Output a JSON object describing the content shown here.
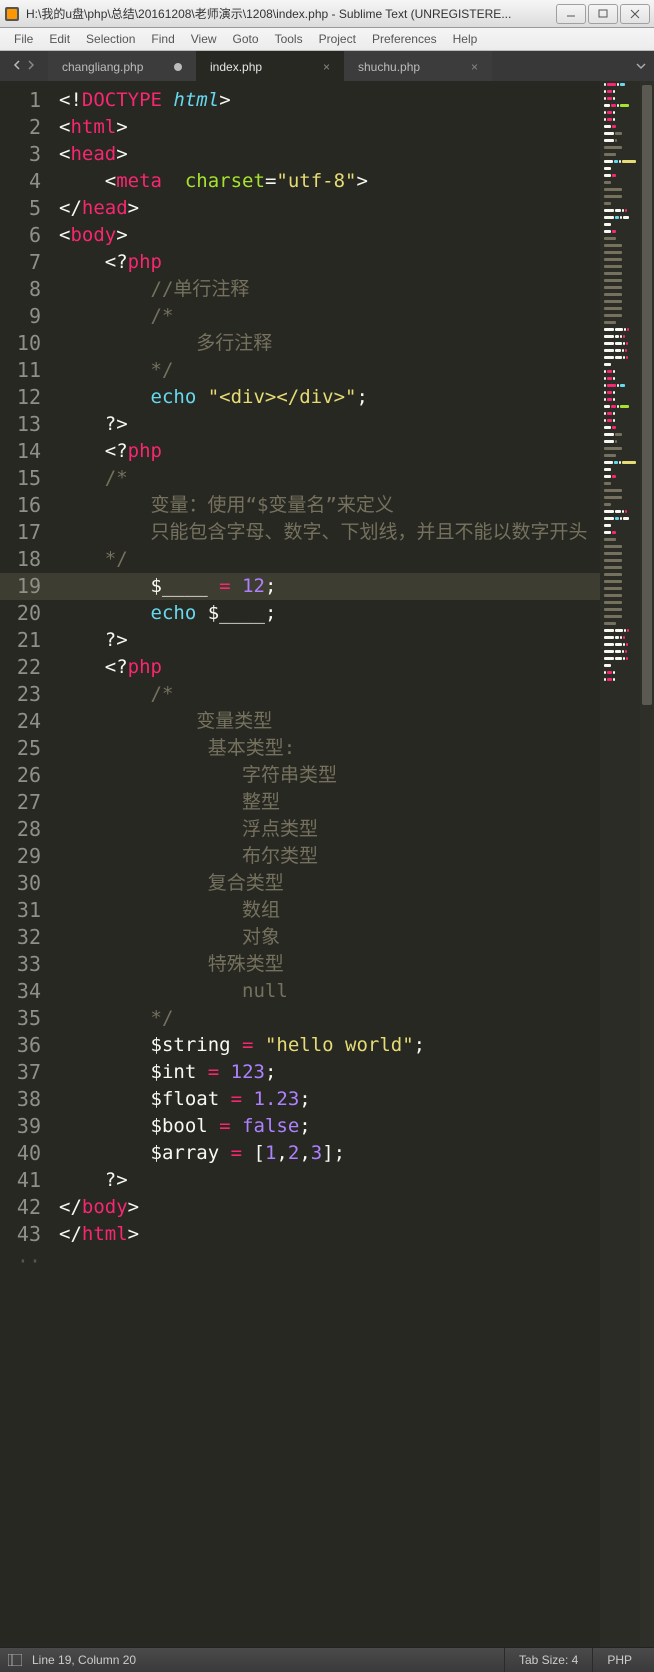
{
  "titlebar": {
    "title": "H:\\我的u盘\\php\\总结\\20161208\\老师演示\\1208\\index.php - Sublime Text (UNREGISTERE..."
  },
  "menu": {
    "items": [
      "File",
      "Edit",
      "Selection",
      "Find",
      "View",
      "Goto",
      "Tools",
      "Project",
      "Preferences",
      "Help"
    ]
  },
  "tabs": {
    "items": [
      {
        "label": "changliang.php",
        "active": false,
        "dirty": true,
        "closeable": false
      },
      {
        "label": "index.php",
        "active": true,
        "dirty": false,
        "closeable": true
      },
      {
        "label": "shuchu.php",
        "active": false,
        "dirty": false,
        "closeable": true
      }
    ]
  },
  "editor": {
    "active_line": 19,
    "lines": [
      {
        "n": 1,
        "segs": [
          [
            "<!",
            "p-white"
          ],
          [
            "DOCTYPE",
            "p-red"
          ],
          [
            " ",
            "p-white"
          ],
          [
            "html",
            "p-blue"
          ],
          [
            ">",
            "p-white"
          ]
        ]
      },
      {
        "n": 2,
        "segs": [
          [
            "<",
            "p-white"
          ],
          [
            "html",
            "p-red"
          ],
          [
            ">",
            "p-white"
          ]
        ]
      },
      {
        "n": 3,
        "segs": [
          [
            "<",
            "p-white"
          ],
          [
            "head",
            "p-red"
          ],
          [
            ">",
            "p-white"
          ]
        ]
      },
      {
        "n": 4,
        "segs": [
          [
            "    <",
            "p-white"
          ],
          [
            "meta",
            "p-red"
          ],
          [
            "  ",
            "p-white"
          ],
          [
            "charset",
            "p-green"
          ],
          [
            "=",
            "p-white"
          ],
          [
            "\"utf-8\"",
            "p-yellow"
          ],
          [
            ">",
            "p-white"
          ]
        ]
      },
      {
        "n": 5,
        "segs": [
          [
            "</",
            "p-white"
          ],
          [
            "head",
            "p-red"
          ],
          [
            ">",
            "p-white"
          ]
        ]
      },
      {
        "n": 6,
        "segs": [
          [
            "<",
            "p-white"
          ],
          [
            "body",
            "p-red"
          ],
          [
            ">",
            "p-white"
          ]
        ]
      },
      {
        "n": 7,
        "segs": [
          [
            "    <?",
            "p-white"
          ],
          [
            "php",
            "p-red"
          ]
        ]
      },
      {
        "n": 8,
        "segs": [
          [
            "        ",
            "p-white"
          ],
          [
            "//单行注释",
            "p-comment"
          ]
        ]
      },
      {
        "n": 9,
        "segs": [
          [
            "        ",
            "p-white"
          ],
          [
            "/*",
            "p-comment"
          ]
        ]
      },
      {
        "n": 10,
        "segs": [
          [
            "            多行注释",
            "p-comment"
          ]
        ]
      },
      {
        "n": 11,
        "segs": [
          [
            "        */",
            "p-comment"
          ]
        ]
      },
      {
        "n": 12,
        "segs": [
          [
            "        ",
            "p-white"
          ],
          [
            "echo",
            "p-cyan"
          ],
          [
            " ",
            "p-white"
          ],
          [
            "\"<div></div>\"",
            "p-yellow"
          ],
          [
            ";",
            "p-white"
          ]
        ]
      },
      {
        "n": 13,
        "segs": [
          [
            "    ?>",
            "p-white"
          ]
        ]
      },
      {
        "n": 14,
        "segs": [
          [
            "    <?",
            "p-white"
          ],
          [
            "php",
            "p-red"
          ]
        ]
      },
      {
        "n": 15,
        "segs": [
          [
            "    /*",
            "p-comment"
          ]
        ]
      },
      {
        "n": 16,
        "segs": [
          [
            "        变量：使用“$变量名”来定义",
            "p-comment"
          ]
        ]
      },
      {
        "n": 17,
        "segs": [
          [
            "        只能包含字母、数字、下划线，并且不能以数字开头",
            "p-comment"
          ]
        ]
      },
      {
        "n": 18,
        "segs": [
          [
            "    */",
            "p-comment"
          ]
        ]
      },
      {
        "n": 19,
        "segs": [
          [
            "        ",
            "p-white"
          ],
          [
            "$____",
            "p-white"
          ],
          [
            " ",
            "p-white"
          ],
          [
            "=",
            "p-red"
          ],
          [
            " ",
            "p-white"
          ],
          [
            "12",
            "p-purple"
          ],
          [
            ";",
            "p-white"
          ]
        ]
      },
      {
        "n": 20,
        "segs": [
          [
            "        ",
            "p-white"
          ],
          [
            "echo",
            "p-cyan"
          ],
          [
            " ",
            "p-white"
          ],
          [
            "$____",
            "p-white"
          ],
          [
            ";",
            "p-white"
          ]
        ]
      },
      {
        "n": 21,
        "segs": [
          [
            "    ?>",
            "p-white"
          ]
        ]
      },
      {
        "n": 22,
        "segs": [
          [
            "    <?",
            "p-white"
          ],
          [
            "php",
            "p-red"
          ]
        ]
      },
      {
        "n": 23,
        "segs": [
          [
            "        /*",
            "p-comment"
          ]
        ]
      },
      {
        "n": 24,
        "segs": [
          [
            "            变量类型",
            "p-comment"
          ]
        ]
      },
      {
        "n": 25,
        "segs": [
          [
            "             基本类型:",
            "p-comment"
          ]
        ]
      },
      {
        "n": 26,
        "segs": [
          [
            "                字符串类型",
            "p-comment"
          ]
        ]
      },
      {
        "n": 27,
        "segs": [
          [
            "                整型",
            "p-comment"
          ]
        ]
      },
      {
        "n": 28,
        "segs": [
          [
            "                浮点类型",
            "p-comment"
          ]
        ]
      },
      {
        "n": 29,
        "segs": [
          [
            "                布尔类型",
            "p-comment"
          ]
        ]
      },
      {
        "n": 30,
        "segs": [
          [
            "             复合类型",
            "p-comment"
          ]
        ]
      },
      {
        "n": 31,
        "segs": [
          [
            "                数组",
            "p-comment"
          ]
        ]
      },
      {
        "n": 32,
        "segs": [
          [
            "                对象",
            "p-comment"
          ]
        ]
      },
      {
        "n": 33,
        "segs": [
          [
            "             特殊类型",
            "p-comment"
          ]
        ]
      },
      {
        "n": 34,
        "segs": [
          [
            "                null",
            "p-comment"
          ]
        ]
      },
      {
        "n": 35,
        "segs": [
          [
            "        */",
            "p-comment"
          ]
        ]
      },
      {
        "n": 36,
        "segs": [
          [
            "        ",
            "p-white"
          ],
          [
            "$string",
            "p-white"
          ],
          [
            " ",
            "p-white"
          ],
          [
            "=",
            "p-red"
          ],
          [
            " ",
            "p-white"
          ],
          [
            "\"hello world\"",
            "p-yellow"
          ],
          [
            ";",
            "p-white"
          ]
        ]
      },
      {
        "n": 37,
        "segs": [
          [
            "        ",
            "p-white"
          ],
          [
            "$int",
            "p-white"
          ],
          [
            " ",
            "p-white"
          ],
          [
            "=",
            "p-red"
          ],
          [
            " ",
            "p-white"
          ],
          [
            "123",
            "p-purple"
          ],
          [
            ";",
            "p-white"
          ]
        ]
      },
      {
        "n": 38,
        "segs": [
          [
            "        ",
            "p-white"
          ],
          [
            "$float",
            "p-white"
          ],
          [
            " ",
            "p-white"
          ],
          [
            "=",
            "p-red"
          ],
          [
            " ",
            "p-white"
          ],
          [
            "1.23",
            "p-purple"
          ],
          [
            ";",
            "p-white"
          ]
        ]
      },
      {
        "n": 39,
        "segs": [
          [
            "        ",
            "p-white"
          ],
          [
            "$bool",
            "p-white"
          ],
          [
            " ",
            "p-white"
          ],
          [
            "=",
            "p-red"
          ],
          [
            " ",
            "p-white"
          ],
          [
            "false",
            "p-purple"
          ],
          [
            ";",
            "p-white"
          ]
        ]
      },
      {
        "n": 40,
        "segs": [
          [
            "        ",
            "p-white"
          ],
          [
            "$array",
            "p-white"
          ],
          [
            " ",
            "p-white"
          ],
          [
            "=",
            "p-red"
          ],
          [
            " [",
            "p-white"
          ],
          [
            "1",
            "p-purple"
          ],
          [
            ",",
            "p-white"
          ],
          [
            "2",
            "p-purple"
          ],
          [
            ",",
            "p-white"
          ],
          [
            "3",
            "p-purple"
          ],
          [
            "];",
            "p-white"
          ]
        ]
      },
      {
        "n": 41,
        "segs": [
          [
            "    ?>",
            "p-white"
          ]
        ]
      },
      {
        "n": 42,
        "segs": [
          [
            "</",
            "p-white"
          ],
          [
            "body",
            "p-red"
          ],
          [
            ">",
            "p-white"
          ]
        ]
      },
      {
        "n": 43,
        "segs": [
          [
            "</",
            "p-white"
          ],
          [
            "html",
            "p-red"
          ],
          [
            ">",
            "p-white"
          ]
        ]
      }
    ]
  },
  "statusbar": {
    "position": "Line 19, Column 20",
    "tab_size": "Tab Size: 4",
    "syntax": "PHP"
  },
  "colors": {
    "minimap": [
      "#f92672",
      "#a6e22e",
      "#e6db74",
      "#75715e",
      "#66d9ef",
      "#f8f8f2",
      "#ae81ff"
    ]
  }
}
